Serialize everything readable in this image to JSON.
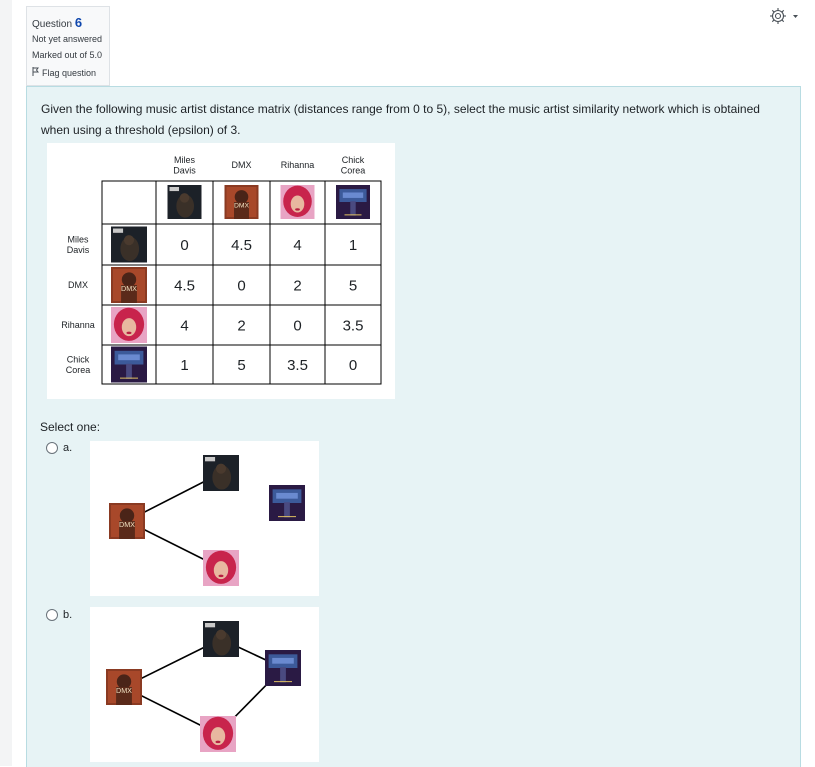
{
  "question": {
    "label": "Question",
    "number": "6",
    "status": "Not yet answered",
    "marks": "Marked out of 5.0",
    "flag": "Flag question"
  },
  "prompt": "Given the following music artist distance matrix (distances range from 0 to 5), select the music artist similarity network which is obtained when using a threshold (epsilon) of 3.",
  "matrix": {
    "col_headers": [
      [
        "Miles",
        "Davis"
      ],
      [
        "DMX"
      ],
      [
        "Rihanna"
      ],
      [
        "Chick",
        "Corea"
      ]
    ],
    "row_headers": [
      [
        "Miles",
        "Davis"
      ],
      [
        "DMX"
      ],
      [
        "Rihanna"
      ],
      [
        "Chick",
        "Corea"
      ]
    ],
    "values": [
      [
        "0",
        "4.5",
        "4",
        "1"
      ],
      [
        "4.5",
        "0",
        "2",
        "5"
      ],
      [
        "4",
        "2",
        "0",
        "3.5"
      ],
      [
        "1",
        "5",
        "3.5",
        "0"
      ]
    ],
    "dmx_cover_text": "DMX"
  },
  "select_label": "Select one:",
  "options": [
    {
      "label": "a.",
      "nodes": [
        "Miles Davis",
        "DMX",
        "Rihanna",
        "Chick Corea"
      ],
      "edges": [
        [
          "DMX",
          "Miles Davis"
        ],
        [
          "DMX",
          "Rihanna"
        ]
      ]
    },
    {
      "label": "b.",
      "nodes": [
        "Miles Davis",
        "DMX",
        "Rihanna",
        "Chick Corea"
      ],
      "edges": [
        [
          "DMX",
          "Miles Davis"
        ],
        [
          "DMX",
          "Rihanna"
        ],
        [
          "Miles Davis",
          "Chick Corea"
        ],
        [
          "Rihanna",
          "Chick Corea"
        ]
      ]
    }
  ],
  "icons": {
    "settings": "gear-icon",
    "settings_menu": "caret-down-icon",
    "flag": "flag-icon"
  },
  "colors": {
    "accent": "#0f47ad",
    "content_bg": "#e7f3f5",
    "content_border": "#b8dce2"
  }
}
